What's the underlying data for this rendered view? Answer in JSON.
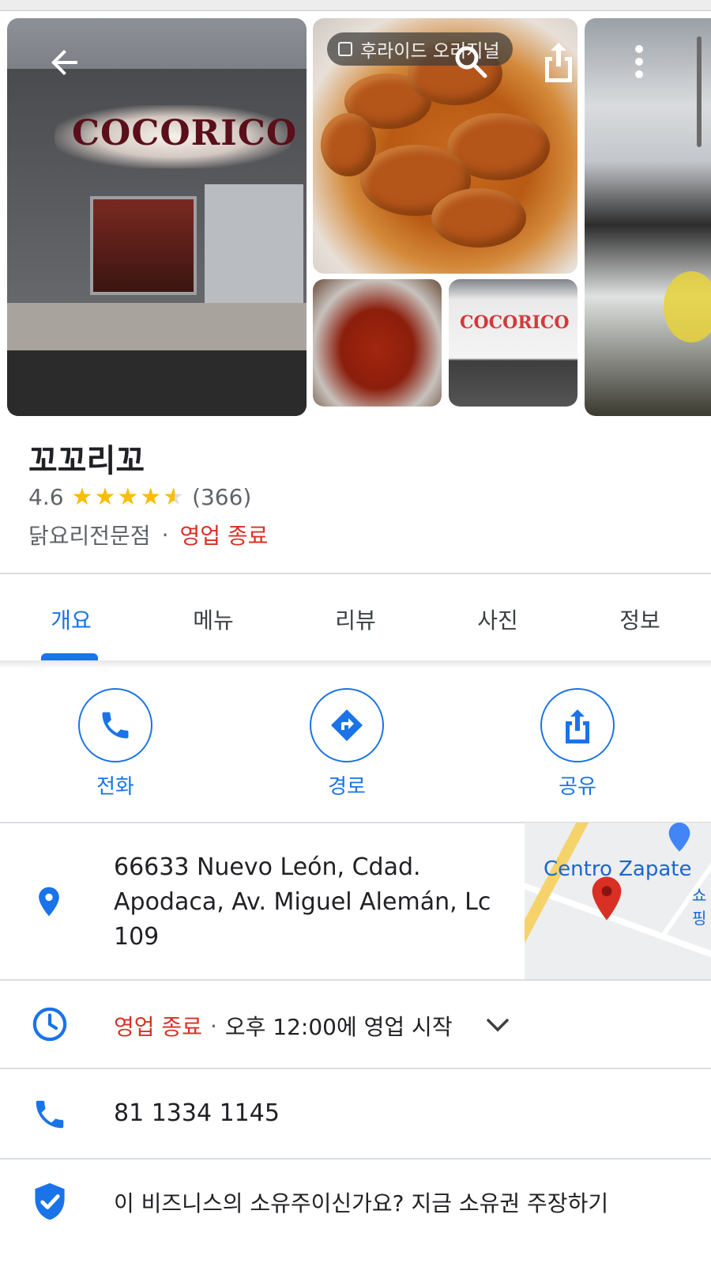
{
  "header": {
    "resolution_chip": "후라이드 오리지널"
  },
  "photos": {
    "storefront_sign": "COCORICO",
    "storefront_small_sign": "COCORICO"
  },
  "place": {
    "name": "꼬꼬리꼬",
    "rating": "4.6",
    "stars_value": 4.6,
    "review_count": "(366)",
    "category": "닭요리전문점",
    "separator": "·",
    "status": "영업 종료"
  },
  "tabs": [
    {
      "label": "개요",
      "active": true
    },
    {
      "label": "메뉴",
      "active": false
    },
    {
      "label": "리뷰",
      "active": false
    },
    {
      "label": "사진",
      "active": false
    },
    {
      "label": "정보",
      "active": false
    }
  ],
  "actions": {
    "call": "전화",
    "route": "경로",
    "share": "공유"
  },
  "address": {
    "line1": "66633 Nuevo León, Cdad.",
    "line2": "Apodaca, Av. Miguel Alemán, Lc",
    "line3": "109",
    "map_label": "Centro Zapate",
    "map_label_sub": "쇼핑"
  },
  "hours": {
    "status": "영업 종료",
    "separator": "·",
    "next": "오후 12:00에 영업 시작"
  },
  "phone": "81 1334 1145",
  "claim": "이 비즈니스의 소유주이신가요? 지금 소유권 주장하기",
  "colors": {
    "accent": "#1a73e8",
    "closed": "#d93025",
    "star": "#fbbc04"
  },
  "icons": [
    "back-arrow-icon",
    "search-icon",
    "share-icon",
    "more-vert-icon",
    "photo-icon",
    "phone-icon",
    "directions-icon",
    "location-pin-icon",
    "clock-icon",
    "chevron-down-icon",
    "verified-shield-icon",
    "map-pin-icon"
  ]
}
